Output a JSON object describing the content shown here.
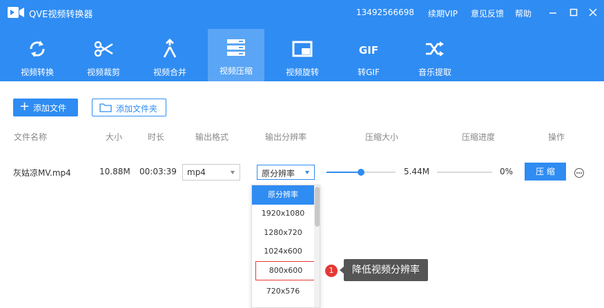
{
  "app": {
    "title": "QVE视频转换器",
    "phone": "13492566698",
    "links": [
      "续期VIP",
      "意见反馈",
      "帮助"
    ]
  },
  "toolbar": {
    "items": [
      {
        "label": "视频转换",
        "icon": "convert-icon"
      },
      {
        "label": "视频裁剪",
        "icon": "scissors-icon"
      },
      {
        "label": "视频合并",
        "icon": "merge-icon"
      },
      {
        "label": "视频压缩",
        "icon": "compress-icon",
        "active": true
      },
      {
        "label": "视频旋转",
        "icon": "rotate-icon"
      },
      {
        "label": "转GIF",
        "icon": "gif-icon",
        "glyph": "GIF"
      },
      {
        "label": "音乐提取",
        "icon": "shuffle-icon"
      }
    ]
  },
  "actions": {
    "add_file": "添加文件",
    "add_folder": "添加文件夹"
  },
  "columns": [
    "文件名称",
    "大小",
    "时长",
    "输出格式",
    "输出分辨率",
    "压缩大小",
    "压缩进度",
    "操作"
  ],
  "row": {
    "name": "灰姑凉MV.mp4",
    "size": "10.88M",
    "duration": "00:03:39",
    "format": "mp4",
    "resolution": "原分辨率",
    "compress_level": 0.5,
    "compressed_size": "5.44M",
    "progress_percent": "0%",
    "progress_value": 0,
    "compress_button": "压 缩"
  },
  "dropdown": {
    "options": [
      "原分辨率",
      "1920x1080",
      "1280x720",
      "1024x600",
      "800x600",
      "720x576"
    ],
    "selected": "原分辨率",
    "highlighted": "800x600"
  },
  "annotation": {
    "number": "1",
    "text": "降低视频分辨率"
  },
  "colors": {
    "accent": "#2f8cf2",
    "active_tab": "#5aa5f5",
    "highlight": "#e53935"
  }
}
